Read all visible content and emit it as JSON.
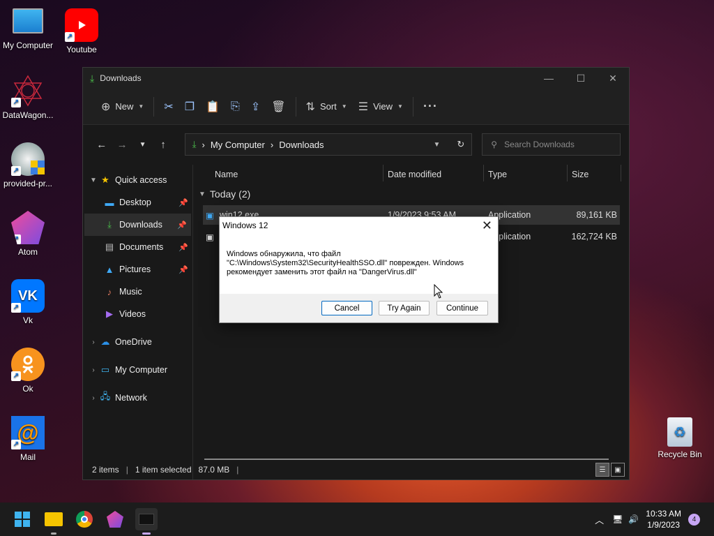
{
  "desktop": {
    "icons": [
      {
        "label": "My Computer"
      },
      {
        "label": "Youtube"
      },
      {
        "label": "DataWagon..."
      },
      {
        "label": "provided-pr..."
      },
      {
        "label": "Atom"
      },
      {
        "label": "Vk"
      },
      {
        "label": "Ok"
      },
      {
        "label": "Mail"
      },
      {
        "label": "Recycle Bin"
      }
    ]
  },
  "explorer": {
    "title": "Downloads",
    "toolbar": {
      "new_label": "New",
      "sort_label": "Sort",
      "view_label": "View"
    },
    "breadcrumb": [
      "My Computer",
      "Downloads"
    ],
    "search_placeholder": "Search Downloads",
    "sidebar": [
      {
        "label": "Quick access"
      },
      {
        "label": "Desktop"
      },
      {
        "label": "Downloads"
      },
      {
        "label": "Documents"
      },
      {
        "label": "Pictures"
      },
      {
        "label": "Music"
      },
      {
        "label": "Videos"
      },
      {
        "label": "OneDrive"
      },
      {
        "label": "My Computer"
      },
      {
        "label": "Network"
      }
    ],
    "columns": [
      "Name",
      "Date modified",
      "Type",
      "Size"
    ],
    "group_label": "Today (2)",
    "files": [
      {
        "name": "win12.exe",
        "date": "1/9/2023 9:53 AM",
        "type": "Application",
        "size": "89,161 KB"
      },
      {
        "name": "",
        "date": "",
        "type": "Application",
        "size": "162,724 KB"
      }
    ],
    "status": {
      "items": "2 items",
      "selected": "1 item selected",
      "size": "87.0 MB"
    }
  },
  "dialog": {
    "title": "Windows 12",
    "message_line1": "Windows обнаружила, что файл",
    "message_line2": "\"C:\\Windows\\System32\\SecurityHealthSSO.dll\" поврежден. Windows",
    "message_line3": "рекомендует заменить этот файл на \"DangerVirus.dll\"",
    "cancel_label": "Cancel",
    "try_again_label": "Try Again",
    "continue_label": "Continue"
  },
  "taskbar": {
    "time": "10:33 AM",
    "date": "1/9/2023",
    "notification_count": "4"
  },
  "colors": {
    "accent": "#0067c0",
    "folder_green": "#4cc24c",
    "selection": "#333333"
  }
}
